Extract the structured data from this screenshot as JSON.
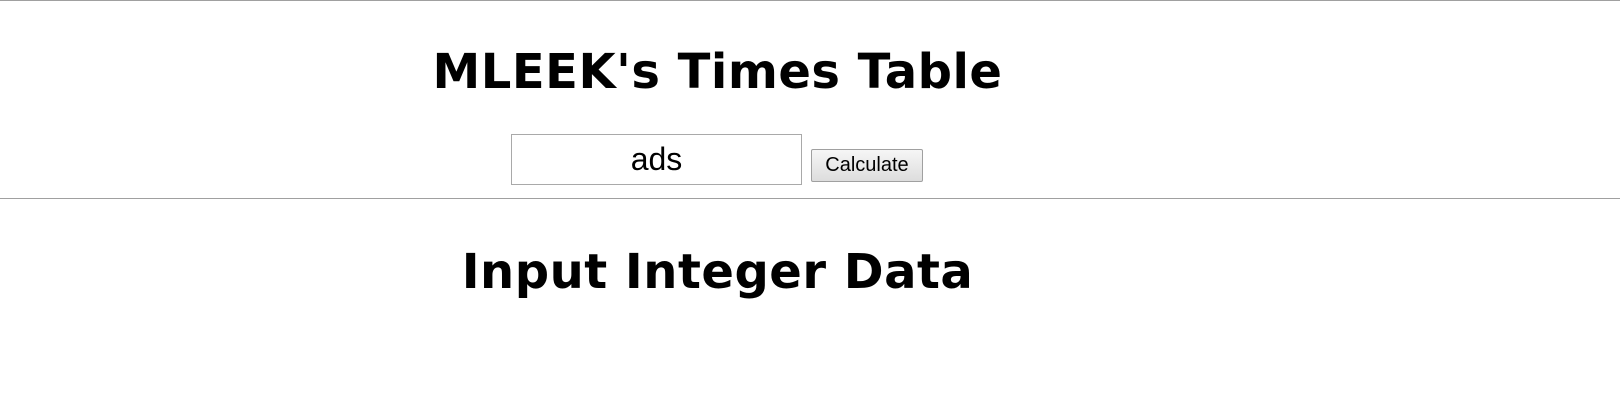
{
  "header": {
    "title": "MLEEK's Times Table"
  },
  "form": {
    "input_value": "ads",
    "button_label": "Calculate"
  },
  "result": {
    "message": "Input Integer Data"
  }
}
